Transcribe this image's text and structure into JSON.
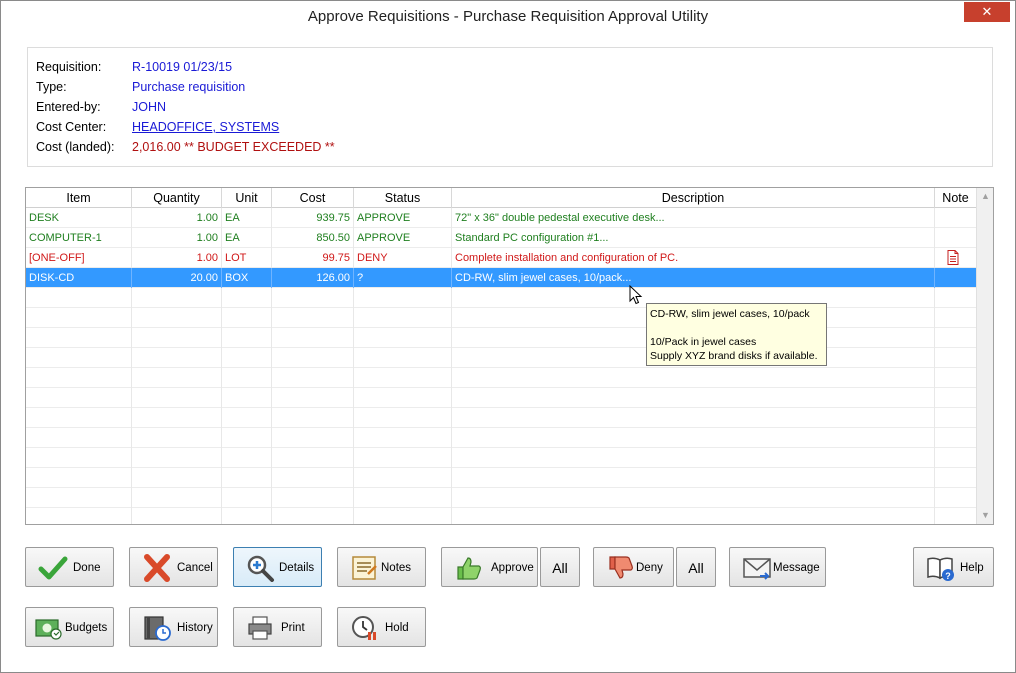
{
  "window": {
    "title": "Approve Requisitions - Purchase Requisition Approval Utility",
    "close_symbol": "✕"
  },
  "info": {
    "requisition_label": "Requisition:",
    "requisition_value": "R-10019  01/23/15",
    "type_label": "Type:",
    "type_value": "Purchase requisition",
    "entered_label": "Entered-by:",
    "entered_value": "JOHN",
    "cost_center_label": "Cost Center:",
    "cost_center_value": "HEADOFFICE, SYSTEMS",
    "cost_label": "Cost (landed):",
    "cost_value": "2,016.00  ** BUDGET EXCEEDED **"
  },
  "grid": {
    "headers": [
      "Item",
      "Quantity",
      "Unit",
      "Cost",
      "Status",
      "Description",
      "Note"
    ],
    "rows": [
      {
        "item": "DESK",
        "qty": "1.00",
        "unit": "EA",
        "cost": "939.75",
        "status": "APPROVE",
        "desc": "72\" x 36\" double pedestal executive desk...",
        "note": ""
      },
      {
        "item": "COMPUTER-1",
        "qty": "1.00",
        "unit": "EA",
        "cost": "850.50",
        "status": "APPROVE",
        "desc": "Standard PC configuration #1...",
        "note": ""
      },
      {
        "item": "[ONE-OFF]",
        "qty": "1.00",
        "unit": "LOT",
        "cost": "99.75",
        "status": "DENY",
        "desc": "Complete installation and configuration of PC.",
        "note": "document-icon"
      },
      {
        "item": "DISK-CD",
        "qty": "20.00",
        "unit": "BOX",
        "cost": "126.00",
        "status": "?",
        "desc": "CD-RW, slim jewel cases, 10/pack...",
        "note": ""
      }
    ]
  },
  "tooltip": {
    "line1": "CD-RW, slim jewel cases, 10/pack",
    "line2": "10/Pack in jewel cases",
    "line3": "Supply XYZ brand disks if available."
  },
  "buttons": {
    "done": "Done",
    "cancel": "Cancel",
    "details": "Details",
    "notes": "Notes",
    "approve": "Approve",
    "approve_all": "All",
    "deny": "Deny",
    "deny_all": "All",
    "message": "Message",
    "help": "Help",
    "budgets": "Budgets",
    "history": "History",
    "print": "Print",
    "hold": "Hold"
  },
  "colors": {
    "approve": "#1f7f1f",
    "deny": "#d01818",
    "selection": "#3399ff",
    "info_value": "#1a1ad6",
    "warning": "#b01010",
    "close": "#c7402d"
  }
}
